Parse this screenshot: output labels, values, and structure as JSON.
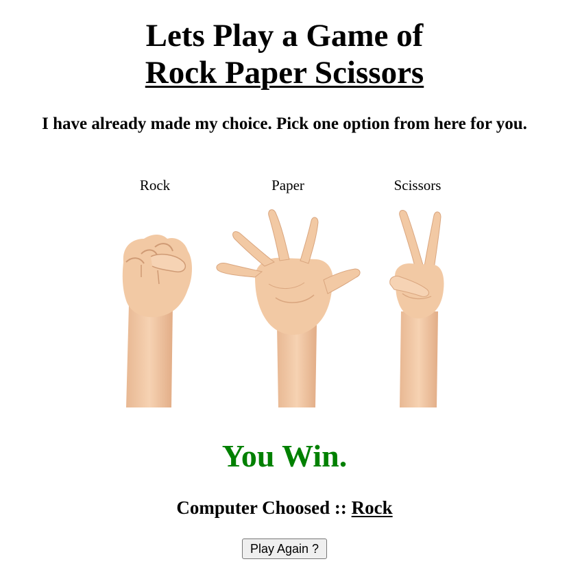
{
  "header": {
    "title_line1": "Lets Play a Game of",
    "title_line2": "Rock Paper Scissors",
    "subtitle": "I have already made my choice. Pick one option from here for you."
  },
  "choices": [
    {
      "label": "Rock",
      "icon": "rock-hand-icon"
    },
    {
      "label": "Paper",
      "icon": "paper-hand-icon"
    },
    {
      "label": "Scissors",
      "icon": "scissors-hand-icon"
    }
  ],
  "result": {
    "text": "You Win.",
    "color": "#008000"
  },
  "computer": {
    "prefix": "Computer Choosed ::",
    "choice": "Rock"
  },
  "actions": {
    "play_again_label": "Play Again ?"
  },
  "colors": {
    "skin": "#f2c9a4",
    "skin_shadow": "#d9a57e"
  }
}
